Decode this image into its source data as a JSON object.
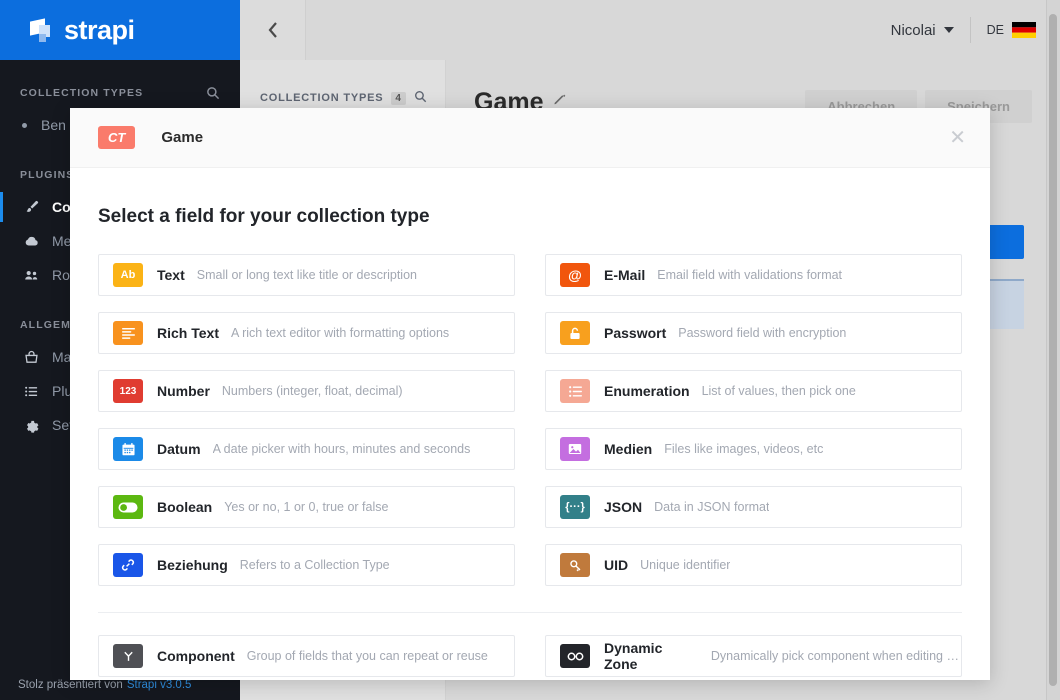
{
  "brand": {
    "name": "strapi",
    "logo_icon": "strapi-logo-icon"
  },
  "sidebar": {
    "collection_types_label": "COLLECTION TYPES",
    "search_icon": "search-icon",
    "collection_items": [
      {
        "label": "Ben",
        "icon": "bullet-dot-icon"
      }
    ],
    "plugins_label": "PLUGINS",
    "plugin_items": [
      {
        "label": "Con",
        "icon": "brush-icon",
        "active": true
      },
      {
        "label": "Med",
        "icon": "cloud-upload-icon",
        "active": false
      },
      {
        "label": "Roll",
        "icon": "users-icon",
        "active": false
      }
    ],
    "general_label": "ALLGEM",
    "general_items": [
      {
        "label": "Mar",
        "icon": "shop-basket-icon"
      },
      {
        "label": "Plug",
        "icon": "list-icon"
      },
      {
        "label": "Sett",
        "icon": "gear-icon"
      }
    ],
    "footer_text": "Stolz präsentiert von",
    "footer_link": "Strapi v3.0.5"
  },
  "topbar": {
    "collapse_icon": "chevron-left-icon",
    "user_name": "Nicolai",
    "user_caret_icon": "chevron-down-icon",
    "language_code": "DE",
    "flag_icon": "german-flag-icon"
  },
  "page": {
    "subnav_label": "COLLECTION TYPES",
    "subnav_count": "4",
    "subnav_search_icon": "search-icon",
    "title": "Game",
    "edit_icon": "pencil-icon",
    "cancel_label": "Abbrechen",
    "save_label": "Speichern"
  },
  "modal": {
    "badge": "CT",
    "header_title": "Game",
    "close_icon": "close-icon",
    "heading": "Select a field for your collection type",
    "fields_left": [
      {
        "name": "Text",
        "desc": "Small or long text like title or description",
        "icon": "text-ab-icon",
        "glyph": "Ab",
        "color": "#fbb316"
      },
      {
        "name": "Rich Text",
        "desc": "A rich text editor with formatting options",
        "icon": "rich-text-icon",
        "glyph": "☰",
        "color": "#f8921e"
      },
      {
        "name": "Number",
        "desc": "Numbers (integer, float, decimal)",
        "icon": "number-123-icon",
        "glyph": "123",
        "color": "#e03c31"
      },
      {
        "name": "Datum",
        "desc": "A date picker with hours, minutes and seconds",
        "icon": "calendar-icon",
        "glyph": "Ὄ5",
        "color": "#1b8ae8"
      },
      {
        "name": "Boolean",
        "desc": "Yes or no, 1 or 0, true or false",
        "icon": "toggle-icon",
        "glyph": "",
        "color": "#5cb811"
      },
      {
        "name": "Beziehung",
        "desc": "Refers to a Collection Type",
        "icon": "relation-link-icon",
        "glyph": "⚭",
        "color": "#1a56e8"
      }
    ],
    "fields_right": [
      {
        "name": "E-Mail",
        "desc": "Email field with validations format",
        "icon": "email-at-icon",
        "glyph": "@",
        "color": "#f1560d"
      },
      {
        "name": "Passwort",
        "desc": "Password field with encryption",
        "icon": "lock-icon",
        "glyph": "ὑ3",
        "color": "#f8a01e"
      },
      {
        "name": "Enumeration",
        "desc": "List of values, then pick one",
        "icon": "enumeration-list-icon",
        "glyph": "☰",
        "color": "#f5a894"
      },
      {
        "name": "Medien",
        "desc": "Files like images, videos, etc",
        "icon": "media-image-icon",
        "glyph": "Ὓc",
        "color": "#c46ee0"
      },
      {
        "name": "JSON",
        "desc": "Data in JSON format",
        "icon": "json-braces-icon",
        "glyph": "{···}",
        "color": "#328089"
      },
      {
        "name": "UID",
        "desc": "Unique identifier",
        "icon": "uid-key-icon",
        "glyph": "⚿",
        "color": "#c07a3c"
      }
    ],
    "fields_bottom": [
      {
        "name": "Component",
        "desc": "Group of fields that you can repeat or reuse",
        "icon": "component-icon",
        "glyph": "⑂",
        "color": "#4f5055"
      },
      {
        "name": "Dynamic Zone",
        "desc": "Dynamically pick component when editing c...",
        "icon": "dynamic-zone-infinity-icon",
        "glyph": "∞",
        "color": "#23252a"
      }
    ]
  },
  "colors": {
    "brand_blue": "#0c6ede",
    "sidebar_dark": "#15181f",
    "badge_red": "#fa7b6b"
  }
}
